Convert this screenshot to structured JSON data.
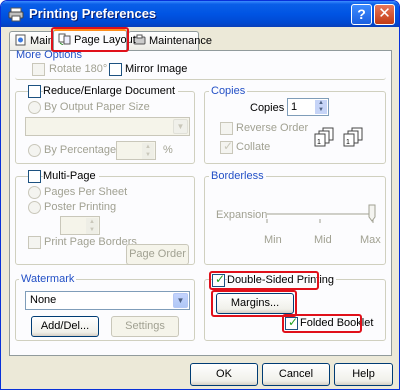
{
  "window": {
    "title": "Printing Preferences"
  },
  "title_buttons": {
    "help": "?",
    "close": "✕"
  },
  "tabs": [
    {
      "label": "Main",
      "selected": false
    },
    {
      "label": "Page Layout",
      "selected": true
    },
    {
      "label": "Maintenance",
      "selected": false
    }
  ],
  "more_options": {
    "label": "More Options",
    "rotate": {
      "label": "Rotate 180°",
      "checked": false,
      "enabled": false
    },
    "mirror": {
      "label": "Mirror Image",
      "checked": false,
      "enabled": true
    }
  },
  "reduce_enlarge": {
    "label": "Reduce/Enlarge Document",
    "checked": false,
    "by_output_paper_size": "By Output Paper Size",
    "paper_size_value": "",
    "by_percentage": "By Percentage",
    "percentage_value": "",
    "percent_unit": "%"
  },
  "copies": {
    "label": "Copies",
    "copies_label": "Copies",
    "copies_value": "1",
    "reverse_order": {
      "label": "Reverse Order",
      "checked": false
    },
    "collate": {
      "label": "Collate",
      "checked": true
    }
  },
  "multi_page": {
    "label": "Multi-Page",
    "checked": false,
    "pages_per_sheet": "Pages Per Sheet",
    "poster_printing": "Poster Printing",
    "spin_value": "",
    "print_page_borders": {
      "label": "Print Page Borders",
      "checked": false
    },
    "page_order": "Page Order"
  },
  "borderless": {
    "label": "Borderless",
    "expansion": "Expansion",
    "ticks": [
      "Min",
      "Mid",
      "Max"
    ],
    "level": "Max"
  },
  "watermark": {
    "label": "Watermark",
    "value": "None",
    "add_del": "Add/Del...",
    "settings": "Settings"
  },
  "double_sided": {
    "label": "Double-Sided Printing",
    "checked": true,
    "margins": "Margins...",
    "folded_booklet": {
      "label": "Folded Booklet",
      "checked": true
    }
  },
  "footer": {
    "ok": "OK",
    "cancel": "Cancel",
    "help": "Help"
  },
  "colors": {
    "accent_group": "#2350c6",
    "highlight": "#e0101a",
    "titlebar": "#0054e3"
  }
}
